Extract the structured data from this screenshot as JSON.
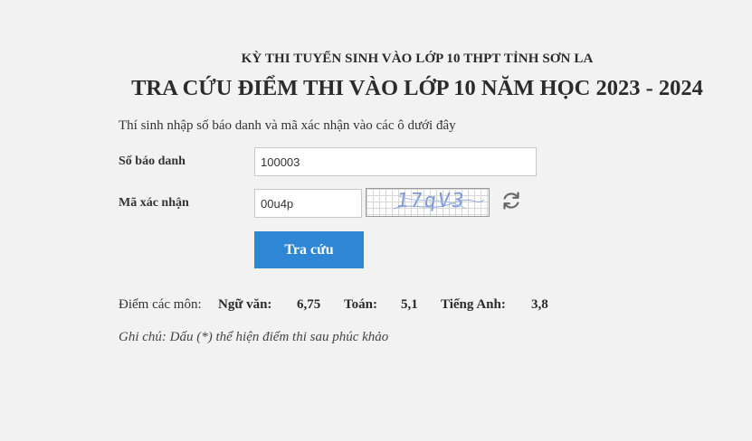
{
  "header": {
    "subtitle": "KỲ THI TUYỂN SINH VÀO LỚP 10 THPT TỈNH SƠN LA",
    "title": "TRA CỨU ĐIỂM THI VÀO LỚP 10 NĂM HỌC 2023 - 2024"
  },
  "form": {
    "instruction": "Thí sinh nhập số báo danh và mã xác nhận vào các ô dưới đây",
    "sbd_label": "Số báo danh",
    "sbd_value": "100003",
    "captcha_label": "Mã xác nhận",
    "captcha_value": "00u4p",
    "captcha_image_text": "17qV3",
    "refresh_icon": "refresh-icon",
    "submit_label": "Tra cứu",
    "accent_color": "#2f86d4"
  },
  "results": {
    "label": "Điểm các môn:",
    "subjects": [
      {
        "name": "Ngữ văn:",
        "score": "6,75"
      },
      {
        "name": "Toán:",
        "score": "5,1"
      },
      {
        "name": "Tiếng Anh:",
        "score": "3,8"
      }
    ]
  },
  "note": "Ghi chú: Dấu (*) thể hiện điểm thi sau phúc khảo"
}
